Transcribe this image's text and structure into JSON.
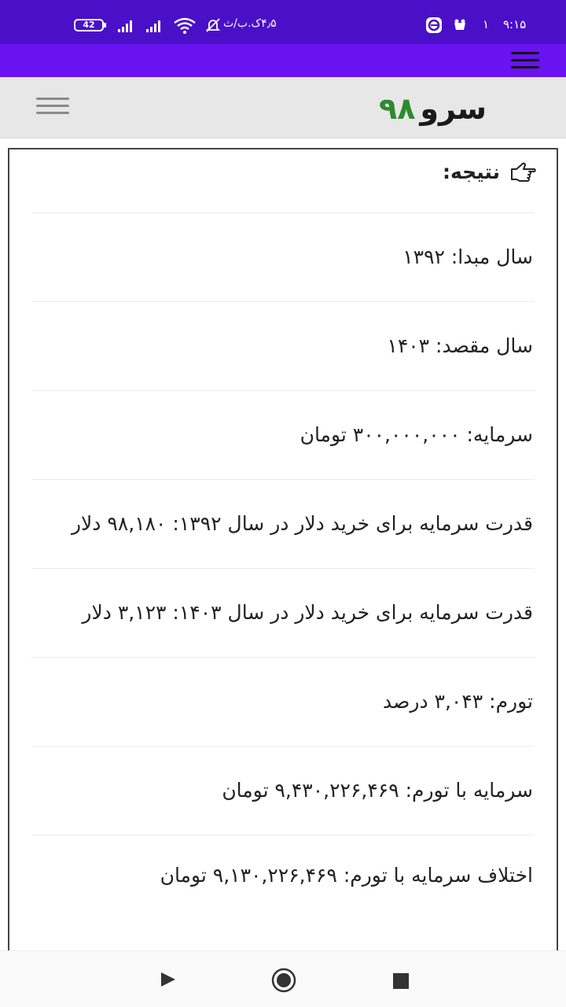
{
  "status_bar": {
    "time": "۹:۱۵",
    "notification_count": "۱",
    "network_speed": "۴٫۵ک.ب/ث",
    "battery": "42",
    "colors": {
      "background": "#4a10c8"
    }
  },
  "top_bar": {
    "menu_icon": "hamburger-icon",
    "color": "#6a12f0"
  },
  "site_header": {
    "logo_text": "سرو",
    "logo_number": "۹۸",
    "logo_number_color": "#2e8a2e",
    "menu_icon": "hamburger-icon"
  },
  "result": {
    "header_icon": "hand-pointing-icon",
    "header_label": "نتیجه:",
    "rows": [
      "سال مبدا: ۱۳۹۲",
      "سال مقصد: ۱۴۰۳",
      "سرمایه: ۳۰۰,۰۰۰,۰۰۰ تومان",
      "قدرت سرمایه برای خرید دلار در سال ۱۳۹۲: ۹۸,۱۸۰ دلار",
      "قدرت سرمایه برای خرید دلار در سال ۱۴۰۳: ۳,۱۲۳ دلار",
      "تورم: ۳,۰۴۳ درصد",
      "سرمایه با تورم: ۹,۴۳۰,۲۲۶,۴۶۹ تومان",
      "اختلاف سرمایه با تورم: ۹,۱۳۰,۲۲۶,۴۶۹ تومان"
    ]
  },
  "nav_bar": {
    "back_icon": "back-triangle-icon",
    "home_icon": "home-circle-icon",
    "recent_icon": "recent-square-icon"
  }
}
